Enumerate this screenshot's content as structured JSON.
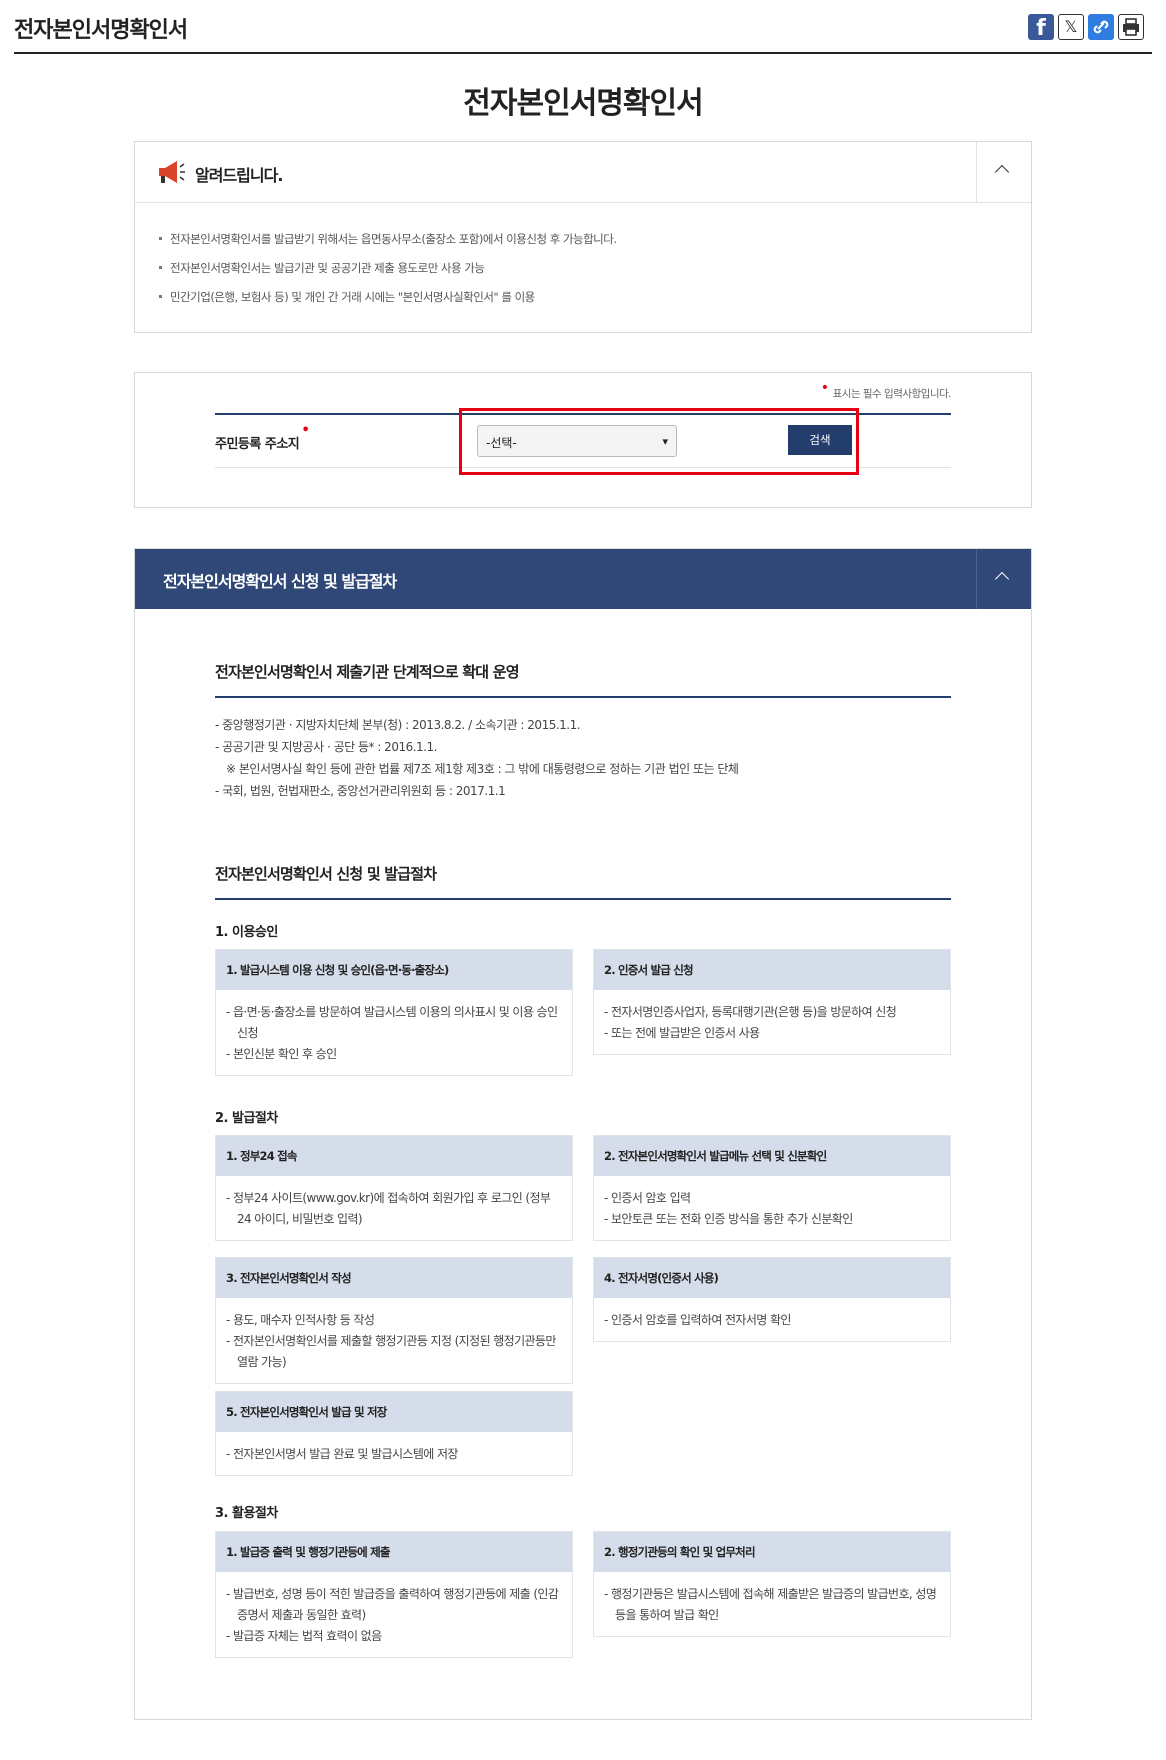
{
  "header": {
    "title": "전자본인서명확인서"
  },
  "share": {
    "facebook": "f",
    "x": "𝕏"
  },
  "page_title": "전자본인서명확인서",
  "notice": {
    "title": "알려드립니다.",
    "items": [
      "전자본인서명확인서를 발급받기 위해서는 읍면동사무소(출장소 포함)에서 이용신청 후 가능합니다.",
      "전자본인서명확인서는 발급기관 및 공공기관 제출 용도로만 사용 가능",
      "민간기업(은행, 보험사 등) 및 개인 간 거래 시에는 \"본인서명사실확인서\" 를 이용"
    ]
  },
  "form": {
    "required_note": "표시는 필수 입력사항입니다.",
    "label": "주민등록 주소지",
    "select_value": "-선택-",
    "search_button": "검색"
  },
  "procedure": {
    "header": "전자본인서명확인서 신청 및 발급절차",
    "section1": {
      "title": "전자본인서명확인서 제출기관 단계적으로 확대 운영",
      "lines": [
        "- 중앙행정기관 · 지방자치단체 본부(청) : 2013.8.2. / 소속기관 : 2015.1.1.",
        "- 공공기관 및 지방공사 · 공단 등* : 2016.1.1.",
        "※ 본인서명사실 확인 등에 관한 법률 제7조 제1항 제3호 : 그 밖에 대통령령으로 정하는 기관 법인 또는 단체",
        "- 국회, 법원, 헌법재판소, 중앙선거관리위원회 등 : 2017.1.1"
      ]
    },
    "section2": {
      "title": "전자본인서명확인서 신청 및 발급절차",
      "step1": {
        "title": "1. 이용승인",
        "cards": [
          {
            "title": "1. 발급시스템 이용 신청 및 승인(읍·면·동·출장소)",
            "lines": [
              "- 읍·면·동·출장소를 방문하여 발급시스템 이용의 의사표시 및 이용 승인 신청",
              "- 본인신분 확인 후 승인"
            ]
          },
          {
            "title": "2. 인증서 발급 신청",
            "lines": [
              "- 전자서명인증사업자, 등록대행기관(은행 등)을 방문하여 신청",
              "- 또는 전에 발급받은 인증서 사용"
            ]
          }
        ]
      },
      "step2": {
        "title": "2. 발급절차",
        "cards": [
          {
            "title": "1. 정부24 접속",
            "lines": [
              "- 정부24 사이트(www.gov.kr)에 접속하여 회원가입 후 로그인 (정부24 아이디, 비밀번호 입력)"
            ]
          },
          {
            "title": "2. 전자본인서명확인서 발급메뉴 선택 및 신분확인",
            "lines": [
              "- 인증서 암호 입력",
              "- 보안토큰 또는 전화 인증 방식을 통한 추가 신분확인"
            ]
          },
          {
            "title": "3. 전자본인서명확인서 작성",
            "lines": [
              "- 용도, 매수자 인적사항 등 작성",
              "- 전자본인서명확인서를 제출할 행정기관등 지정 (지정된 행정기관등만 열람 가능)"
            ]
          },
          {
            "title": "4. 전자서명(인증서 사용)",
            "lines": [
              "- 인증서 암호를 입력하여 전자서명 확인"
            ]
          },
          {
            "title": "5. 전자본인서명확인서 발급 및 저장",
            "lines": [
              "- 전자본인서명서 발급 완료 및 발급시스템에 저장"
            ]
          }
        ]
      },
      "step3": {
        "title": "3. 활용절차",
        "cards": [
          {
            "title": "1. 발급증 출력 및 행정기관등에 제출",
            "lines": [
              "- 발급번호, 성명 등이 적힌 발급증을 출력하여 행정기관등에 제출 (인감증명서 제출과 동일한 효력)",
              "- 발급증 자체는 법적 효력이 없음"
            ]
          },
          {
            "title": "2. 행정기관등의 확인 및 업무처리",
            "lines": [
              "- 행정기관등은 발급시스템에 접속해 제출받은 발급증의 발급번호, 성명 등을 통하여 발급 확인"
            ]
          }
        ]
      }
    }
  },
  "colors": {
    "navy": "#233e6c",
    "header_bar": "#2f4877",
    "card_head": "#d5dcea",
    "required": "#e60012"
  }
}
